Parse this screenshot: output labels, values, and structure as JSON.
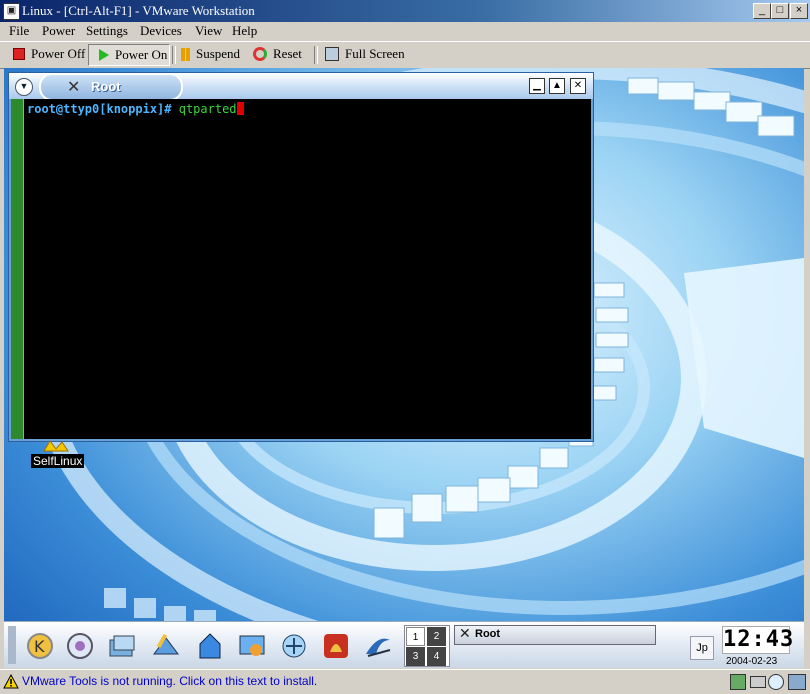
{
  "window": {
    "title": "Linux - [Ctrl-Alt-F1] - VMware Workstation",
    "min_label": "_",
    "max_label": "□",
    "close_label": "×"
  },
  "menu": [
    "File",
    "Power",
    "Settings",
    "Devices",
    "View",
    "Help"
  ],
  "toolbar": {
    "power_off": "Power Off",
    "power_on": "Power On",
    "suspend": "Suspend",
    "reset": "Reset",
    "full_screen": "Full Screen"
  },
  "terminal": {
    "tab_title": "Root",
    "prompt": "root@ttyp0[knoppix]# ",
    "command": "qtparted"
  },
  "desktop": {
    "icon_label": "SelfLinux"
  },
  "taskbar": {
    "pager": [
      "1",
      "2",
      "3",
      "4"
    ],
    "task_title": "Root",
    "clock": "12:43",
    "date": "2004-02-23"
  },
  "status": {
    "text": "VMware Tools is not running. Click on this text to install."
  },
  "colors": {
    "accent": "#0a246a",
    "terminal_bg": "#000000",
    "prompt": "#4db4ff",
    "command": "#3ad43a",
    "cursor": "#e00000"
  }
}
